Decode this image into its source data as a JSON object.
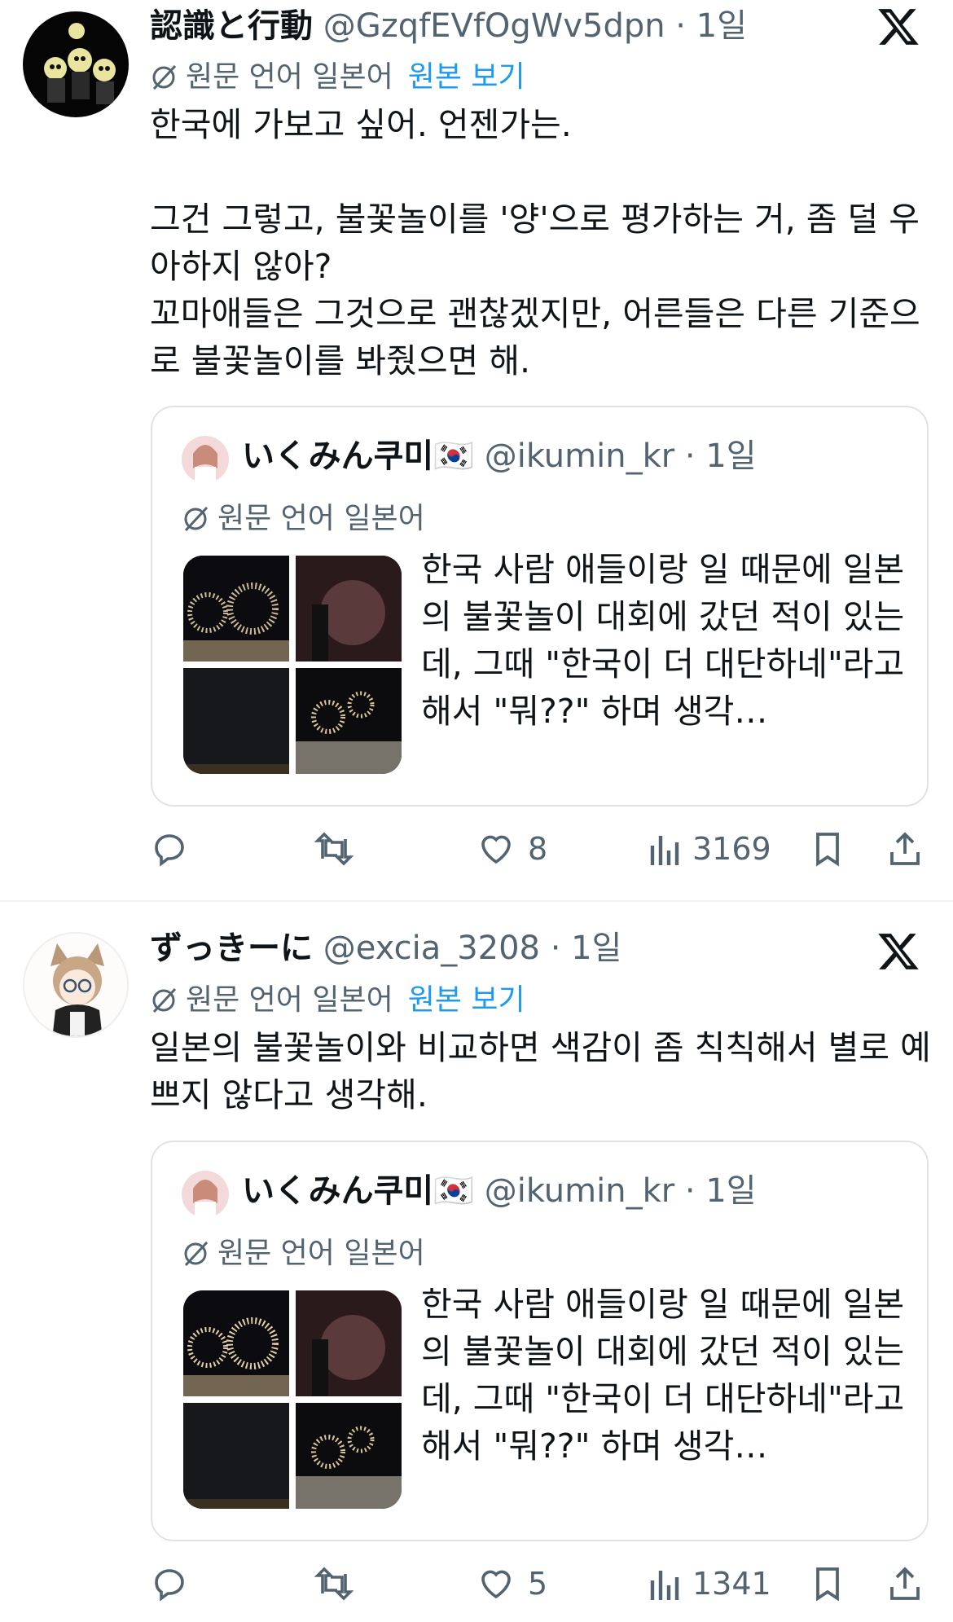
{
  "tweets": [
    {
      "name": "認識と行動",
      "handle": "@GzqfEVfOgWv5dpn",
      "sep": " · ",
      "time": "1일",
      "translate_label": "원문 언어 일본어",
      "translate_link": "원본 보기",
      "text": "한국에 가보고 싶어. 언젠가는.\n\n그건 그렇고, 불꽃놀이를 '양'으로 평가하는 거, 좀 덜 우아하지 않아?\n꼬마애들은 그것으로 괜찮겠지만, 어른들은 다른 기준으로 불꽃놀이를 봐줬으면 해.",
      "quote": {
        "name": "いくみん쿠미🇰🇷",
        "handle": "@ikumin_kr",
        "sep": " · ",
        "time": "1일",
        "translate_label": "원문 언어 일본어",
        "text": "한국 사람 애들이랑 일 때문에 일본의 불꽃놀이 대회에 갔던 적이 있는데, 그때 \"한국이 더 대단하네\"라고 해서 \"뭐??\" 하며 생각…"
      },
      "actions": {
        "reply": "",
        "retweet": "",
        "like": "8",
        "views": "3169"
      }
    },
    {
      "name": "ずっきーに",
      "handle": "@excia_3208",
      "sep": " · ",
      "time": "1일",
      "translate_label": "원문 언어 일본어",
      "translate_link": "원본 보기",
      "text": "일본의 불꽃놀이와 비교하면 색감이 좀 칙칙해서 별로 예쁘지 않다고 생각해.",
      "quote": {
        "name": "いくみん쿠미🇰🇷",
        "handle": "@ikumin_kr",
        "sep": " · ",
        "time": "1일",
        "translate_label": "원문 언어 일본어",
        "text": "한국 사람 애들이랑 일 때문에 일본의 불꽃놀이 대회에 갔던 적이 있는데, 그때 \"한국이 더 대단하네\"라고 해서 \"뭐??\" 하며 생각…"
      },
      "actions": {
        "reply": "",
        "retweet": "",
        "like": "5",
        "views": "1341"
      }
    }
  ],
  "colors": {
    "text": "#0f1419",
    "muted": "#536471",
    "link": "#1d9bf0",
    "border": "#dfe3e6"
  }
}
